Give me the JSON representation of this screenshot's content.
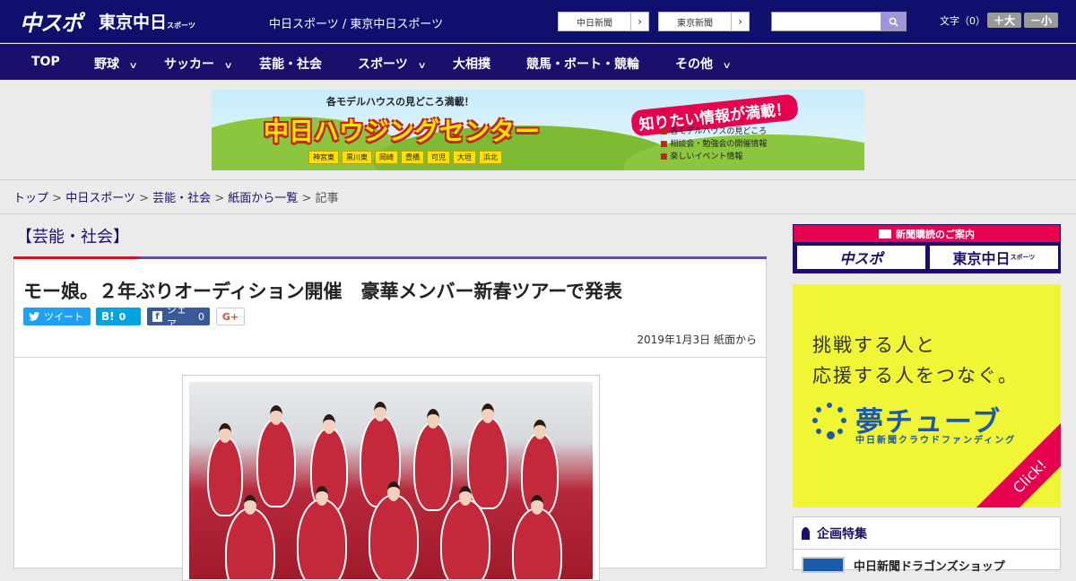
{
  "header": {
    "logo_chuspo": "中スポ",
    "logo_tokyo": "東京中日",
    "logo_tokyo_small": "スポーツ",
    "site_label": "中日スポーツ / 東京中日スポーツ",
    "link_chunichi": "中日新聞",
    "link_tokyo": "東京新聞",
    "link_arrow": "›",
    "search_placeholder": "",
    "font_size_label": "文字（0）",
    "font_plus": "＋大",
    "font_minus": "－小"
  },
  "nav": {
    "items": [
      {
        "label": "TOP",
        "dropdown": false
      },
      {
        "label": "野球",
        "dropdown": true
      },
      {
        "label": "サッカー",
        "dropdown": true
      },
      {
        "label": "芸能・社会",
        "dropdown": false
      },
      {
        "label": "スポーツ",
        "dropdown": true
      },
      {
        "label": "大相撲",
        "dropdown": false
      },
      {
        "label": "競馬・ボート・競輪",
        "dropdown": false
      },
      {
        "label": "その他",
        "dropdown": true
      }
    ],
    "chevron": "∨"
  },
  "banner": {
    "top_text": "各モデルハウスの見どころ満載！",
    "title": "中日ハウジングセンター",
    "badge": "知りたい情報が満載！",
    "list": [
      "各モデルハウスの見どころ",
      "相談会・勉強会の開催情報",
      "楽しいイベント情報"
    ],
    "towns": [
      "神宮東",
      "黒川東",
      "岡崎",
      "豊橋",
      "可児",
      "大垣",
      "浜北"
    ]
  },
  "breadcrumb": {
    "items": [
      "トップ",
      "中日スポーツ",
      "芸能・社会",
      "紙面から一覧"
    ],
    "current": "記事",
    "separator": " > "
  },
  "article": {
    "category": "【芸能・社会】",
    "headline": "モー娘。２年ぶりオーディション開催　豪華メンバー新春ツアーで発表",
    "tweet_label": "ツイート",
    "hatena_label": "B!",
    "hatena_count": "0",
    "facebook_label": "シェア",
    "facebook_count": "0",
    "gplus_label": "G+",
    "date": "2019年1月3日 紙面から"
  },
  "sidebar": {
    "subscribe_header": "新聞購読のご案内",
    "subscribe_chuspo": "中スポ",
    "subscribe_tokyo": "東京中日",
    "subscribe_tokyo_small": "スポーツ",
    "yume_line1": "挑戦する人と",
    "yume_line2": "応援する人をつなぐ。",
    "yume_brand": "夢チューブ",
    "yume_sub": "中日新聞クラウドファンディング",
    "yume_click": "Click!",
    "special_header": "企画特集",
    "special_item": "中日新聞ドラゴンズショップ"
  },
  "colors": {
    "header_bg": "#0f0f6e",
    "nav_bg": "#1a0f6b",
    "accent_red": "#c9191d",
    "accent_pink": "#e6004d",
    "twitter": "#1da1f2",
    "hatena": "#00a4de",
    "facebook": "#3b5998"
  },
  "icons": {
    "search": "magnifier-icon",
    "twitter": "bird-icon",
    "facebook": "f-icon",
    "special": "ribbon-icon",
    "subscribe": "newspaper-icon"
  }
}
